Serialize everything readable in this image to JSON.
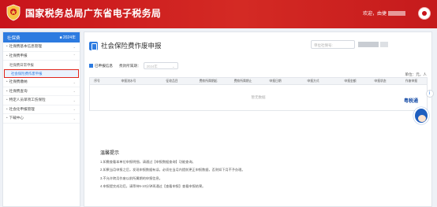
{
  "header": {
    "title": "国家税务总局广东省电子税务局",
    "welcome": "欢迎，由捷"
  },
  "sidebar": {
    "heading": "社保费",
    "badge": "■ 2024年",
    "items": [
      {
        "label": "社保费基本信息管理"
      },
      {
        "label": "社保费申报"
      }
    ],
    "subitems": [
      {
        "label": "社保费日常申报"
      },
      {
        "label": "社会保险费作废申报"
      }
    ],
    "items_after": [
      {
        "label": "社保费缴纳"
      },
      {
        "label": "社保费查询"
      },
      {
        "label": "特定人员单项工伤保险"
      },
      {
        "label": "社会化申报管理"
      },
      {
        "label": "下载中心"
      }
    ]
  },
  "main": {
    "page_title": "社会保险费作废申报",
    "unit_placeholder": "单位社保号:",
    "status": "已申报信息",
    "period_label": "费款所属期：",
    "period_value": "2024年",
    "unit_note": "单位：元，人",
    "table": {
      "columns": [
        "序号",
        "申报流水号",
        "征收品目",
        "费款所属期起",
        "费款所属期止",
        "申报日期",
        "申报方式",
        "申报金额",
        "申报状态",
        "作废申报"
      ],
      "empty_text": "暂无数据"
    },
    "tips": {
      "title": "温馨提示",
      "lines": [
        "1.如需查看本单位申报明细，请通过【申报数据查询】功能查询。",
        "2.如果当月申报之后，发现申报数据有误，必须在当月内提前更正申报数据，否则如下月不予办理。",
        "3.不允许跨月作废以前所属期的申报信息。",
        "4.申报提交成功后，请等待5-10分钟再通过【查看申报】查看申报结果。"
      ]
    }
  },
  "mascot": {
    "label": "粤税通"
  }
}
